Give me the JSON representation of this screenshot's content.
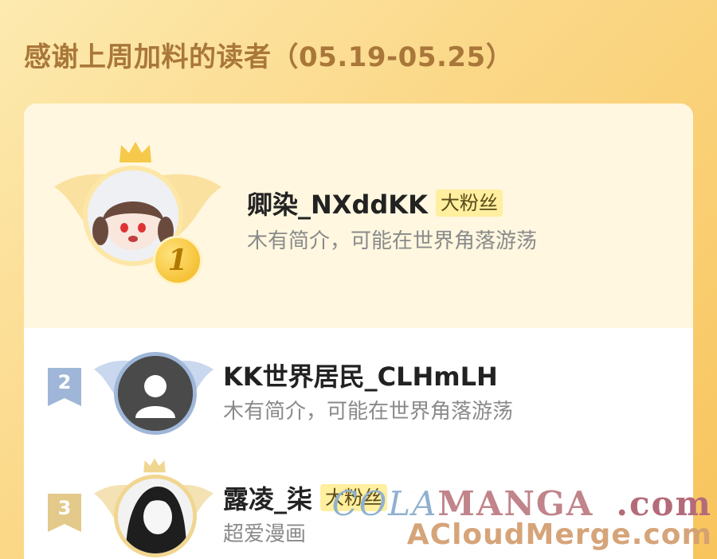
{
  "header": {
    "title": "感谢上周加料的读者（05.19-05.25）"
  },
  "colors": {
    "accent": "#f8c45c",
    "title": "#a9773a",
    "badge_bg": "#ffef9e"
  },
  "readers": [
    {
      "rank": "1",
      "name": "卿染_NXddKK",
      "badge": "大粉丝",
      "bio": "木有简介，可能在世界角落游荡",
      "avatar_icon": "anime-girl-avatar-icon"
    },
    {
      "rank": "2",
      "name": "KK世界居民_CLHmLH",
      "badge": "",
      "bio": "木有简介，可能在世界角落游荡",
      "avatar_icon": "default-user-avatar-icon"
    },
    {
      "rank": "3",
      "name": "露凌_柒",
      "badge": "大粉丝",
      "bio": "超爱漫画",
      "avatar_icon": "manga-avatar-icon"
    }
  ],
  "watermark": {
    "line1a": "COLA",
    "line1b": "MANGA",
    "line1c": ".com",
    "line2": "ACloudMerge.com"
  }
}
